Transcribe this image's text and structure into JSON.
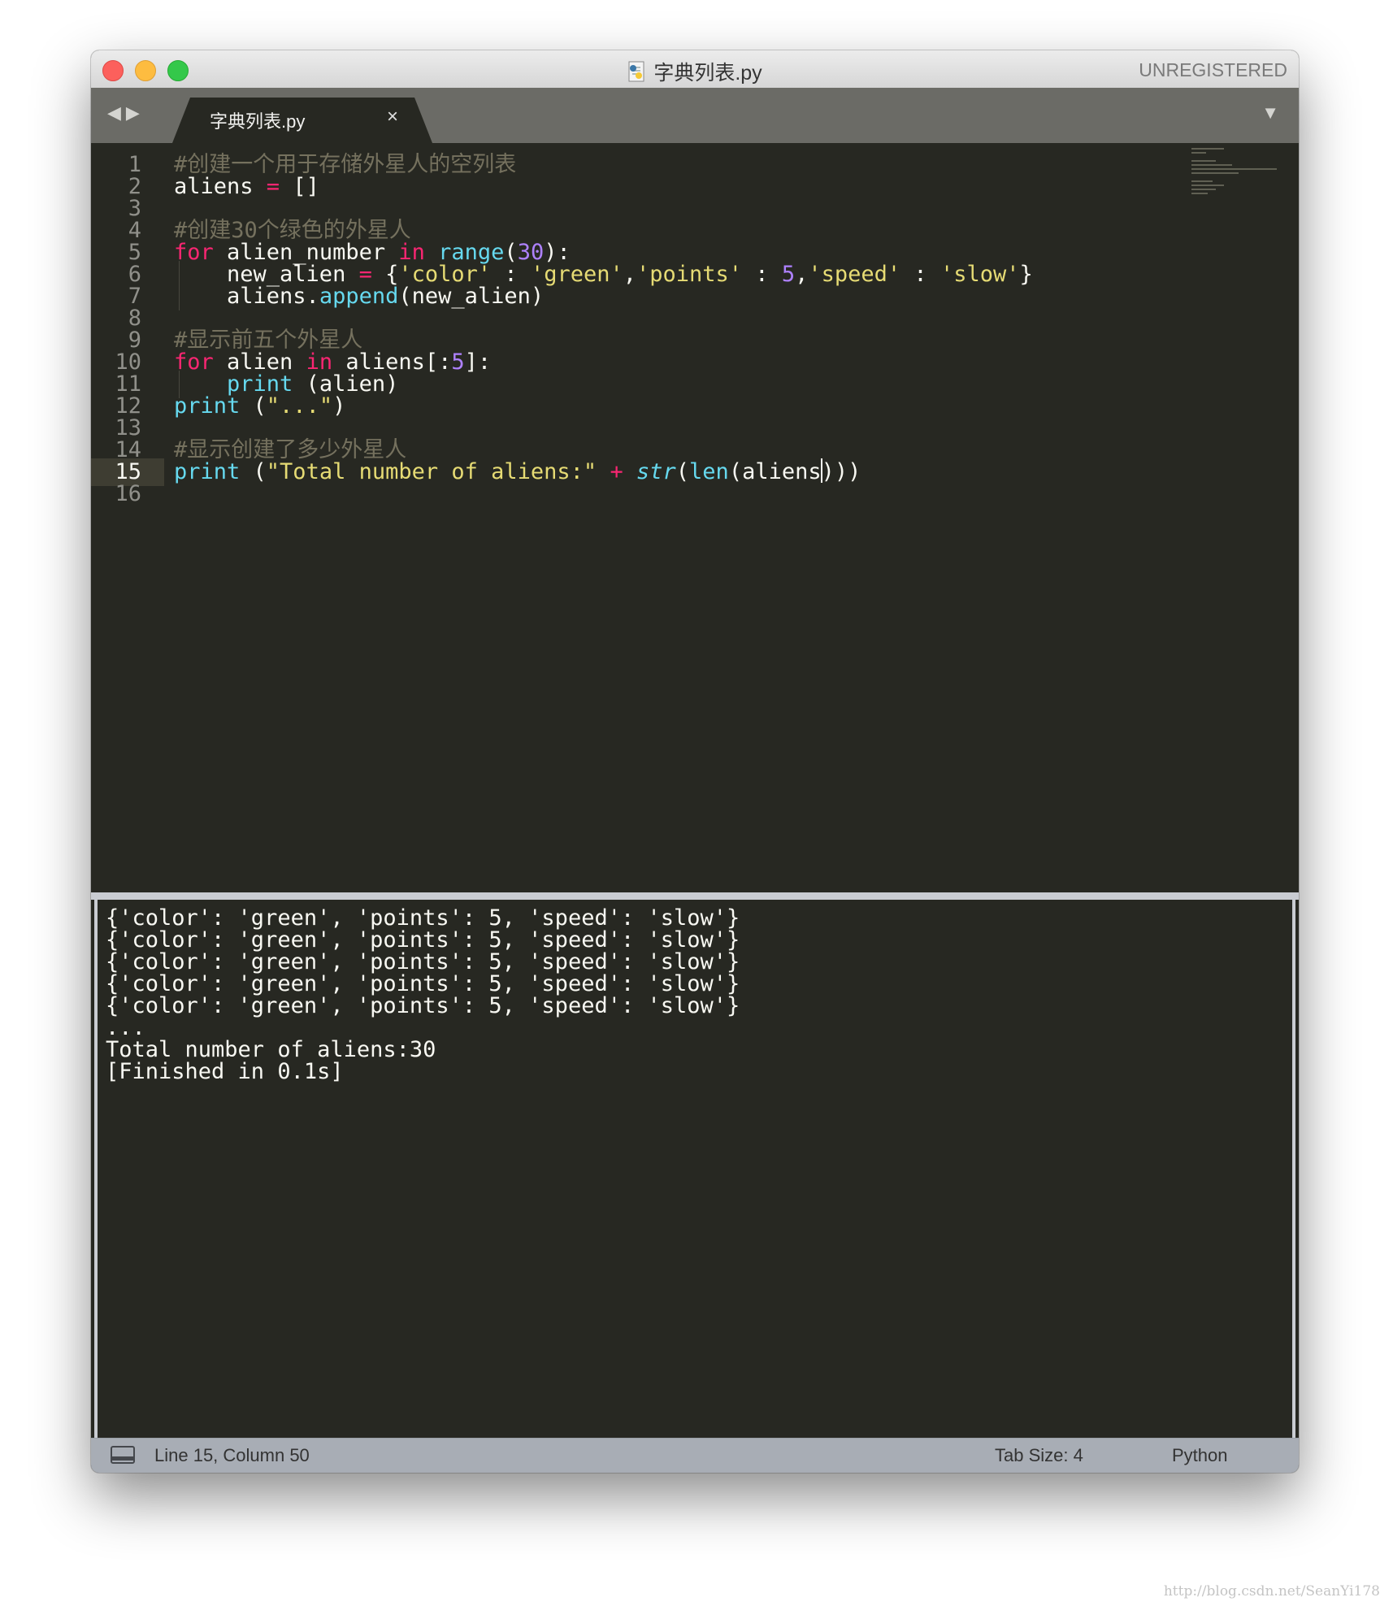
{
  "window": {
    "title": "字典列表.py",
    "registration": "UNREGISTERED"
  },
  "tab": {
    "label": "字典列表.py",
    "close_glyph": "×"
  },
  "nav": {
    "back": "◀",
    "forward": "▶",
    "menu": "▼"
  },
  "editor": {
    "current_line": 15,
    "lines": [
      {
        "n": "1",
        "segs": [
          {
            "t": "#创建一个用于存储外星人的空列表",
            "c": "com"
          }
        ]
      },
      {
        "n": "2",
        "segs": [
          {
            "t": "aliens ",
            "c": ""
          },
          {
            "t": "=",
            "c": "kw"
          },
          {
            "t": " []",
            "c": ""
          }
        ]
      },
      {
        "n": "3",
        "segs": []
      },
      {
        "n": "4",
        "segs": [
          {
            "t": "#创建30个绿色的外星人",
            "c": "com"
          }
        ]
      },
      {
        "n": "5",
        "segs": [
          {
            "t": "for",
            "c": "kw"
          },
          {
            "t": " alien_number ",
            "c": ""
          },
          {
            "t": "in",
            "c": "kw"
          },
          {
            "t": " ",
            "c": ""
          },
          {
            "t": "range",
            "c": "fn"
          },
          {
            "t": "(",
            "c": ""
          },
          {
            "t": "30",
            "c": "num"
          },
          {
            "t": "):",
            "c": ""
          }
        ]
      },
      {
        "n": "6",
        "indent": true,
        "segs": [
          {
            "t": "    new_alien ",
            "c": ""
          },
          {
            "t": "=",
            "c": "kw"
          },
          {
            "t": " {",
            "c": ""
          },
          {
            "t": "'color'",
            "c": "str"
          },
          {
            "t": " : ",
            "c": ""
          },
          {
            "t": "'green'",
            "c": "str"
          },
          {
            "t": ",",
            "c": ""
          },
          {
            "t": "'points'",
            "c": "str"
          },
          {
            "t": " : ",
            "c": ""
          },
          {
            "t": "5",
            "c": "num"
          },
          {
            "t": ",",
            "c": ""
          },
          {
            "t": "'speed'",
            "c": "str"
          },
          {
            "t": " : ",
            "c": ""
          },
          {
            "t": "'slow'",
            "c": "str"
          },
          {
            "t": "}",
            "c": ""
          }
        ]
      },
      {
        "n": "7",
        "indent": true,
        "segs": [
          {
            "t": "    aliens.",
            "c": ""
          },
          {
            "t": "append",
            "c": "fn"
          },
          {
            "t": "(new_alien)",
            "c": ""
          }
        ]
      },
      {
        "n": "8",
        "segs": []
      },
      {
        "n": "9",
        "segs": [
          {
            "t": "#显示前五个外星人",
            "c": "com"
          }
        ]
      },
      {
        "n": "10",
        "segs": [
          {
            "t": "for",
            "c": "kw"
          },
          {
            "t": " alien ",
            "c": ""
          },
          {
            "t": "in",
            "c": "kw"
          },
          {
            "t": " aliens[:",
            "c": ""
          },
          {
            "t": "5",
            "c": "num"
          },
          {
            "t": "]:",
            "c": ""
          }
        ]
      },
      {
        "n": "11",
        "indent": true,
        "segs": [
          {
            "t": "    ",
            "c": ""
          },
          {
            "t": "print",
            "c": "fn"
          },
          {
            "t": " (alien)",
            "c": ""
          }
        ]
      },
      {
        "n": "12",
        "segs": [
          {
            "t": "print",
            "c": "fn"
          },
          {
            "t": " (",
            "c": ""
          },
          {
            "t": "\"...\"",
            "c": "str"
          },
          {
            "t": ")",
            "c": ""
          }
        ]
      },
      {
        "n": "13",
        "segs": []
      },
      {
        "n": "14",
        "segs": [
          {
            "t": "#显示创建了多少外星人",
            "c": "com"
          }
        ]
      },
      {
        "n": "15",
        "segs": [
          {
            "t": "print",
            "c": "fn"
          },
          {
            "t": " (",
            "c": ""
          },
          {
            "t": "\"Total number of aliens:\"",
            "c": "str"
          },
          {
            "t": " ",
            "c": ""
          },
          {
            "t": "+",
            "c": "kw"
          },
          {
            "t": " ",
            "c": ""
          },
          {
            "t": "str",
            "c": "it"
          },
          {
            "t": "(",
            "c": ""
          },
          {
            "t": "len",
            "c": "fn"
          },
          {
            "t": "(aliens",
            "c": ""
          },
          {
            "t": "|",
            "c": "cursor"
          },
          {
            "t": ")))",
            "c": ""
          }
        ]
      },
      {
        "n": "16",
        "segs": []
      }
    ]
  },
  "output": {
    "lines": [
      "{'color': 'green', 'points': 5, 'speed': 'slow'}",
      "{'color': 'green', 'points': 5, 'speed': 'slow'}",
      "{'color': 'green', 'points': 5, 'speed': 'slow'}",
      "{'color': 'green', 'points': 5, 'speed': 'slow'}",
      "{'color': 'green', 'points': 5, 'speed': 'slow'}",
      "...",
      "Total number of aliens:30",
      "[Finished in 0.1s]"
    ]
  },
  "status": {
    "position": "Line 15, Column 50",
    "tab_size": "Tab Size: 4",
    "syntax": "Python"
  },
  "watermark": "http://blog.csdn.net/SeanYi178",
  "colors": {
    "background": "#272822",
    "comment": "#75715e",
    "keyword": "#f92672",
    "function": "#66d9ef",
    "number": "#ae81ff",
    "string": "#e6db74",
    "text": "#f8f8f2"
  }
}
